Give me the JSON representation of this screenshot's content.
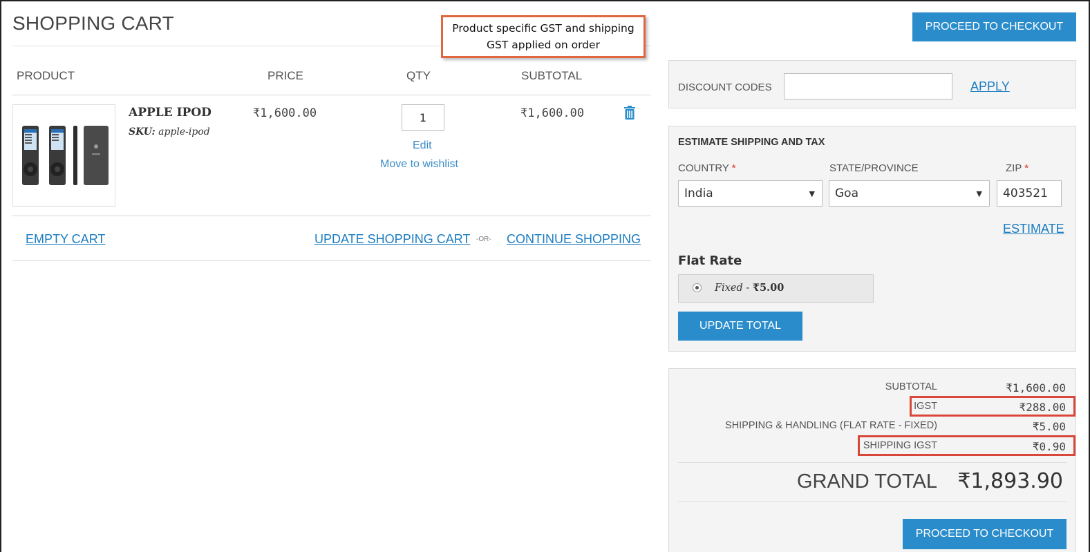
{
  "page": {
    "title": "SHOPPING CART"
  },
  "callout": {
    "line1": "Product specific GST and shipping",
    "line2": "GST applied on order"
  },
  "header": {
    "checkout_label": "PROCEED TO CHECKOUT"
  },
  "table": {
    "columns": [
      "PRODUCT",
      "PRICE",
      "QTY",
      "SUBTOTAL"
    ],
    "items": [
      {
        "name": "APPLE IPOD",
        "sku_label": "SKU:",
        "sku": "apple-ipod",
        "price": "₹1,600.00",
        "qty": "1",
        "subtotal": "₹1,600.00",
        "edit_label": "Edit",
        "wishlist_label": "Move to wishlist",
        "delete_icon": "trash-icon",
        "image_icon": "ipod-product-image"
      }
    ]
  },
  "cart_actions": {
    "empty_cart": "EMPTY CART",
    "update_cart": "UPDATE SHOPPING CART",
    "or": "-OR-",
    "continue_shopping": "CONTINUE SHOPPING"
  },
  "discount": {
    "label": "DISCOUNT CODES",
    "value": "",
    "apply_label": "APPLY"
  },
  "shipping": {
    "heading": "ESTIMATE SHIPPING AND TAX",
    "country_label": "COUNTRY",
    "country_value": "India",
    "state_label": "STATE/PROVINCE",
    "state_value": "Goa",
    "zip_label": "ZIP",
    "zip_value": "403521",
    "required_mark": "*",
    "estimate_label": "ESTIMATE",
    "method_title": "Flat Rate",
    "method_option": "Fixed",
    "method_price": "₹5.00",
    "update_total_label": "UPDATE TOTAL"
  },
  "totals": {
    "subtotal_label": "SUBTOTAL",
    "subtotal_value": "₹1,600.00",
    "igst_label": "IGST",
    "igst_value": "₹288.00",
    "shipping_label": "SHIPPING & HANDLING (FLAT RATE - FIXED)",
    "shipping_value": "₹5.00",
    "shipping_igst_label": "SHIPPING IGST",
    "shipping_igst_value": "₹0.90",
    "grand_total_label": "GRAND TOTAL",
    "grand_total_value": "₹1,893.90",
    "checkout_label": "PROCEED TO CHECKOUT"
  },
  "colors": {
    "accent": "#2a8ccb",
    "link": "#1a7cc1",
    "highlight_red": "#d9473a",
    "callout_orange": "#e0663f"
  }
}
